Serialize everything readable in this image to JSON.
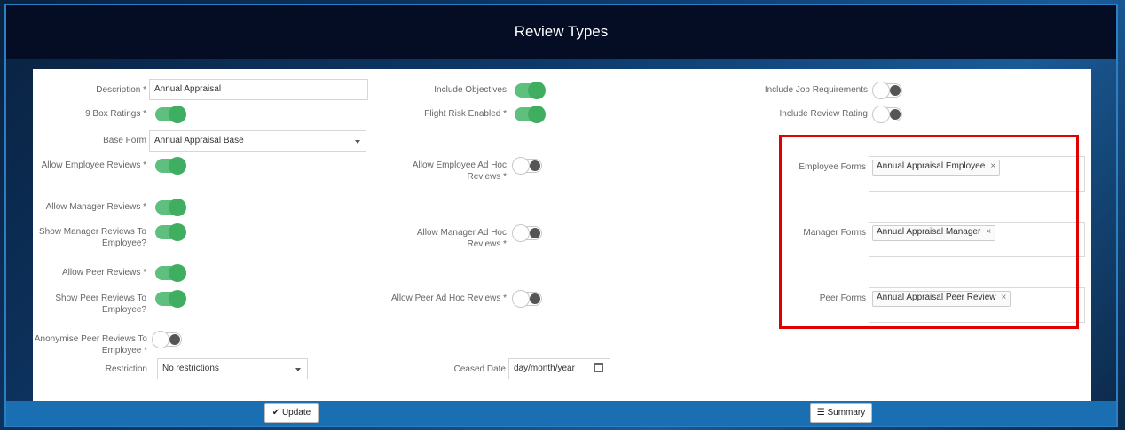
{
  "page": {
    "title": "Review Types"
  },
  "left": {
    "description_label": "Description *",
    "description_value": "Annual Appraisal",
    "nine_box_label": "9 Box Ratings *",
    "base_form_label": "Base Form",
    "base_form_value": "Annual Appraisal Base",
    "allow_employee_reviews_label": "Allow Employee Reviews *",
    "allow_manager_reviews_label": "Allow Manager Reviews *",
    "show_manager_reviews_label_1": "Show Manager Reviews To",
    "show_manager_reviews_label_2": "Employee?",
    "allow_peer_reviews_label": "Allow Peer Reviews *",
    "show_peer_reviews_label_1": "Show Peer Reviews To",
    "show_peer_reviews_label_2": "Employee?",
    "anonymise_label_1": "Anonymise Peer Reviews To",
    "anonymise_label_2": "Employee *",
    "restriction_label": "Restriction",
    "restriction_value": "No restrictions"
  },
  "middle": {
    "include_objectives_label": "Include Objectives",
    "flight_risk_label": "Flight Risk Enabled *",
    "allow_employee_adhoc_label_1": "Allow Employee Ad Hoc",
    "allow_employee_adhoc_label_2": "Reviews *",
    "allow_manager_adhoc_label_1": "Allow Manager Ad Hoc",
    "allow_manager_adhoc_label_2": "Reviews *",
    "allow_peer_adhoc_label": "Allow Peer Ad Hoc Reviews *",
    "ceased_date_label": "Ceased Date",
    "ceased_date_placeholder": "day/month/year"
  },
  "right": {
    "include_job_req_label": "Include Job Requirements",
    "include_review_rating_label": "Include Review Rating",
    "employee_forms_label": "Employee Forms",
    "employee_forms_tag": "Annual Appraisal Employee",
    "manager_forms_label": "Manager Forms",
    "manager_forms_tag": "Annual Appraisal Manager",
    "peer_forms_label": "Peer Forms",
    "peer_forms_tag": "Annual Appraisal Peer Review",
    "tag_remove": "×"
  },
  "toggles": {
    "nine_box": true,
    "allow_employee_reviews": true,
    "allow_manager_reviews": true,
    "show_manager_reviews": true,
    "allow_peer_reviews": true,
    "show_peer_reviews": true,
    "anonymise": false,
    "include_objectives": true,
    "flight_risk": true,
    "allow_employee_adhoc": false,
    "allow_manager_adhoc": false,
    "allow_peer_adhoc": false,
    "include_job_req": false,
    "include_review_rating": false
  },
  "footer": {
    "update_label": "✔ Update",
    "summary_label": "☰ Summary"
  },
  "colors": {
    "accent": "#1a6fb3",
    "toggle_on": "#3fae60",
    "highlight": "#e00000",
    "titlebar": "#040d24"
  }
}
